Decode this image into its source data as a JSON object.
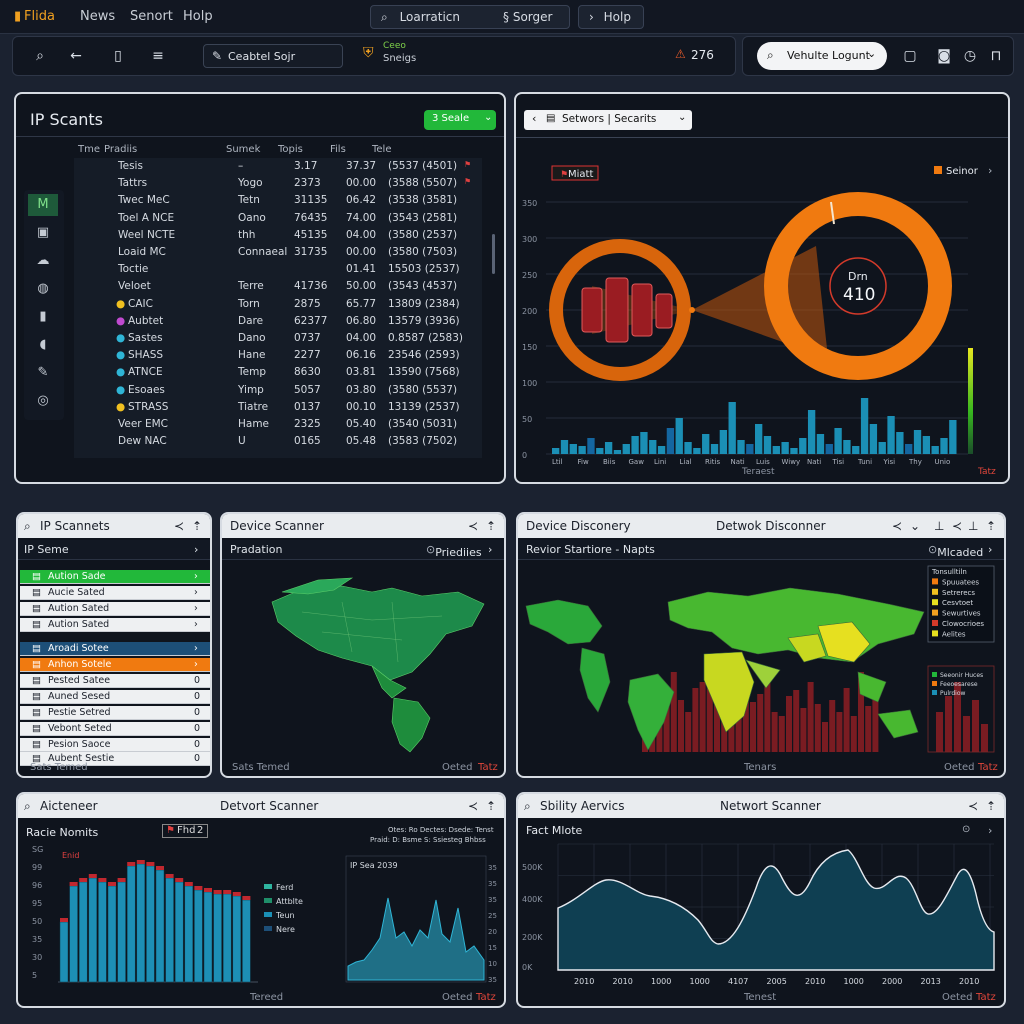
{
  "menubar": {
    "app_name": "Flida",
    "items": [
      "News",
      "Senort",
      "Holp"
    ],
    "location_label": "Loarraticn",
    "senger_label": "Sorger",
    "help_label": "Holp"
  },
  "toolbar": {
    "server_select": "Ceabtel Sojr",
    "badge_top": "Ceeo",
    "badge_bottom": "Sneigs",
    "alert_count": "276",
    "logout_button": "Vehulte Logunt"
  },
  "ip_scants": {
    "title": "IP Scants",
    "action_button": "3 Seale",
    "columns": [
      "Tme",
      "Pradiis",
      "Sumek",
      "Topis",
      "Fils",
      "Tele"
    ],
    "side_icons": [
      "M",
      "doc-icon",
      "cloud-icon",
      "globe-icon",
      "phone-icon",
      "signal-icon",
      "edit-icon",
      "grid-icon"
    ],
    "rows": [
      {
        "name": "Tesis",
        "type": "–",
        "a": "3.17",
        "b": "37.37",
        "c": "(5537 (4501)"
      },
      {
        "name": "Tattrs",
        "type": "Yogo",
        "a": "2373",
        "b": "00.00",
        "c": "(3588 (5507)"
      },
      {
        "name": "Twec MeC",
        "type": "Tetn",
        "a": "31135",
        "b": "06.42",
        "c": "(3538 (3581)"
      },
      {
        "name": "Toel A NCE",
        "type": "Oano",
        "a": "76435",
        "b": "74.00",
        "c": "(3543 (2581)"
      },
      {
        "name": "Weel NCTE",
        "type": "thh",
        "a": "45135",
        "b": "04.00",
        "c": "(3580 (2537)"
      },
      {
        "name": "Loaid MC",
        "type": "Connaeal",
        "a": "31735",
        "b": "00.00",
        "c": "(3580 (7503)"
      },
      {
        "name": "Toctie",
        "type": "",
        "a": "",
        "b": "01.41",
        "c": "15503 (2537)"
      },
      {
        "name": "Veloet",
        "type": "Terre",
        "a": "41736",
        "b": "50.00",
        "c": "(3543 (4537)"
      },
      {
        "name": "CAIC",
        "type": "Torn",
        "a": "2875",
        "b": "65.77",
        "c": "13809 (2384)"
      },
      {
        "name": "Aubtet",
        "type": "Dare",
        "a": "62377",
        "b": "06.80",
        "c": "13579 (3936)"
      },
      {
        "name": "Sastes",
        "type": "Dano",
        "a": "0737",
        "b": "04.00",
        "c": "0.8587 (2583)"
      },
      {
        "name": "SHASS",
        "type": "Hane",
        "a": "2277",
        "b": "06.16",
        "c": "23546 (2593)"
      },
      {
        "name": "ATNCE",
        "type": "Temp",
        "a": "8630",
        "b": "03.81",
        "c": "13590 (7568)"
      },
      {
        "name": "Esoaes",
        "type": "Yimp",
        "a": "5057",
        "b": "03.80",
        "c": "(3580 (5537)"
      },
      {
        "name": "STRASS",
        "type": "Tiatre",
        "a": "0137",
        "b": "00.10",
        "c": "13139 (2537)"
      },
      {
        "name": "Veer EMC",
        "type": "Hame",
        "a": "2325",
        "b": "05.40",
        "c": "(3540 (5031)"
      },
      {
        "name": "Dew NAC",
        "type": "U",
        "a": "0165",
        "b": "05.48",
        "c": "(3583 (7502)"
      }
    ]
  },
  "servers_panel": {
    "breadcrumb": "Setwors | Secarits",
    "tag": "Miatt",
    "legend_label": "Seinor",
    "donut_label": "Drn",
    "donut_value": "410",
    "x_ticks": [
      "Ltil",
      "Fiw",
      "Biis",
      "Gaw",
      "Lini",
      "Lial",
      "Ritis",
      "Nati",
      "Luis",
      "Wiwy",
      "Nati",
      "Tisi",
      "Tuni",
      "Yisi",
      "Thy",
      "Unio"
    ],
    "y_ticks": [
      "350",
      "300",
      "250",
      "200",
      "150",
      "100",
      "50",
      "0"
    ],
    "footer": "Teraest",
    "footer_tag": "Tatz"
  },
  "ip_scannets": {
    "title": "IP Scannets",
    "section": "IP Seme",
    "items": [
      "Aution Sade",
      "Aucie Sated",
      "Aution Sated",
      "Aution Sated",
      "Aroadi Sotee",
      "Anhon Sotele",
      "Pested Satee",
      "Auned Sesed",
      "Pestie Setred",
      "Vebont Seted",
      "Pesion Saoce",
      "Aubent Sestie"
    ],
    "footer": "Sats Temed"
  },
  "device_scanner": {
    "title": "Device Scanner",
    "section": "Pradation",
    "badge": "Priediies",
    "footer_tag": "Tatz",
    "footer": "Oeted"
  },
  "device_discovery": {
    "title": "Device Disconery",
    "title2": "Detwok Disconner",
    "section": "Revior Startiore - Napts",
    "badge": "Mlcaded",
    "legend": [
      "Tonsulltiln",
      "Spuuatees",
      "Setrerecs",
      "Cesvtoet",
      "Sewurtives",
      "Clowocrioes",
      "Aelites"
    ],
    "legend2": [
      "Seeonir Huces",
      "Feeoesarese",
      "Pulrdiow"
    ],
    "footer": "Tenars",
    "footer2": "Oeted",
    "footer_tag": "Tatz"
  },
  "aicteneer": {
    "title": "Aicteneer",
    "title2": "Detvort Scanner",
    "subtitle": "Racie Nomits",
    "tag": "Fhd",
    "tag_num": "2",
    "series_tag": "Enid",
    "legend": [
      "Ferd",
      "Attblte",
      "Teun",
      "Nere"
    ],
    "inset_title": "IP Sea 2039",
    "note1": "Otes: Ro Dectes: Dsede: Tenst",
    "note2": "Praid: D: Bsme S: Ssiesteg Bhbss",
    "y_ticks": [
      "SG",
      "99",
      "96",
      "95",
      "50",
      "35",
      "30",
      "5"
    ],
    "y_ticks_right": [
      "35",
      "35",
      "35",
      "25",
      "20",
      "15",
      "10",
      "35"
    ],
    "footer": "Tereed",
    "footer2": "Oeted",
    "footer_tag": "Tatz"
  },
  "network": {
    "title": "Sbility Aervics",
    "title2": "Networt Scanner",
    "subtitle": "Fact Mlote",
    "y_ticks": [
      "500K",
      "400K",
      "200K",
      "0K"
    ],
    "x_ticks": [
      "2010",
      "2010",
      "1000",
      "1000",
      "4107",
      "2005",
      "2010",
      "1000",
      "2000",
      "2013",
      "2010"
    ],
    "footer": "Tenest",
    "footer2": "Oeted",
    "footer_tag": "Tatz"
  },
  "colors": {
    "orange": "#f07a10",
    "green": "#1fb82e",
    "teal": "#1b8fb5",
    "red": "#c0282f",
    "blue_dark": "#1d4f78"
  }
}
